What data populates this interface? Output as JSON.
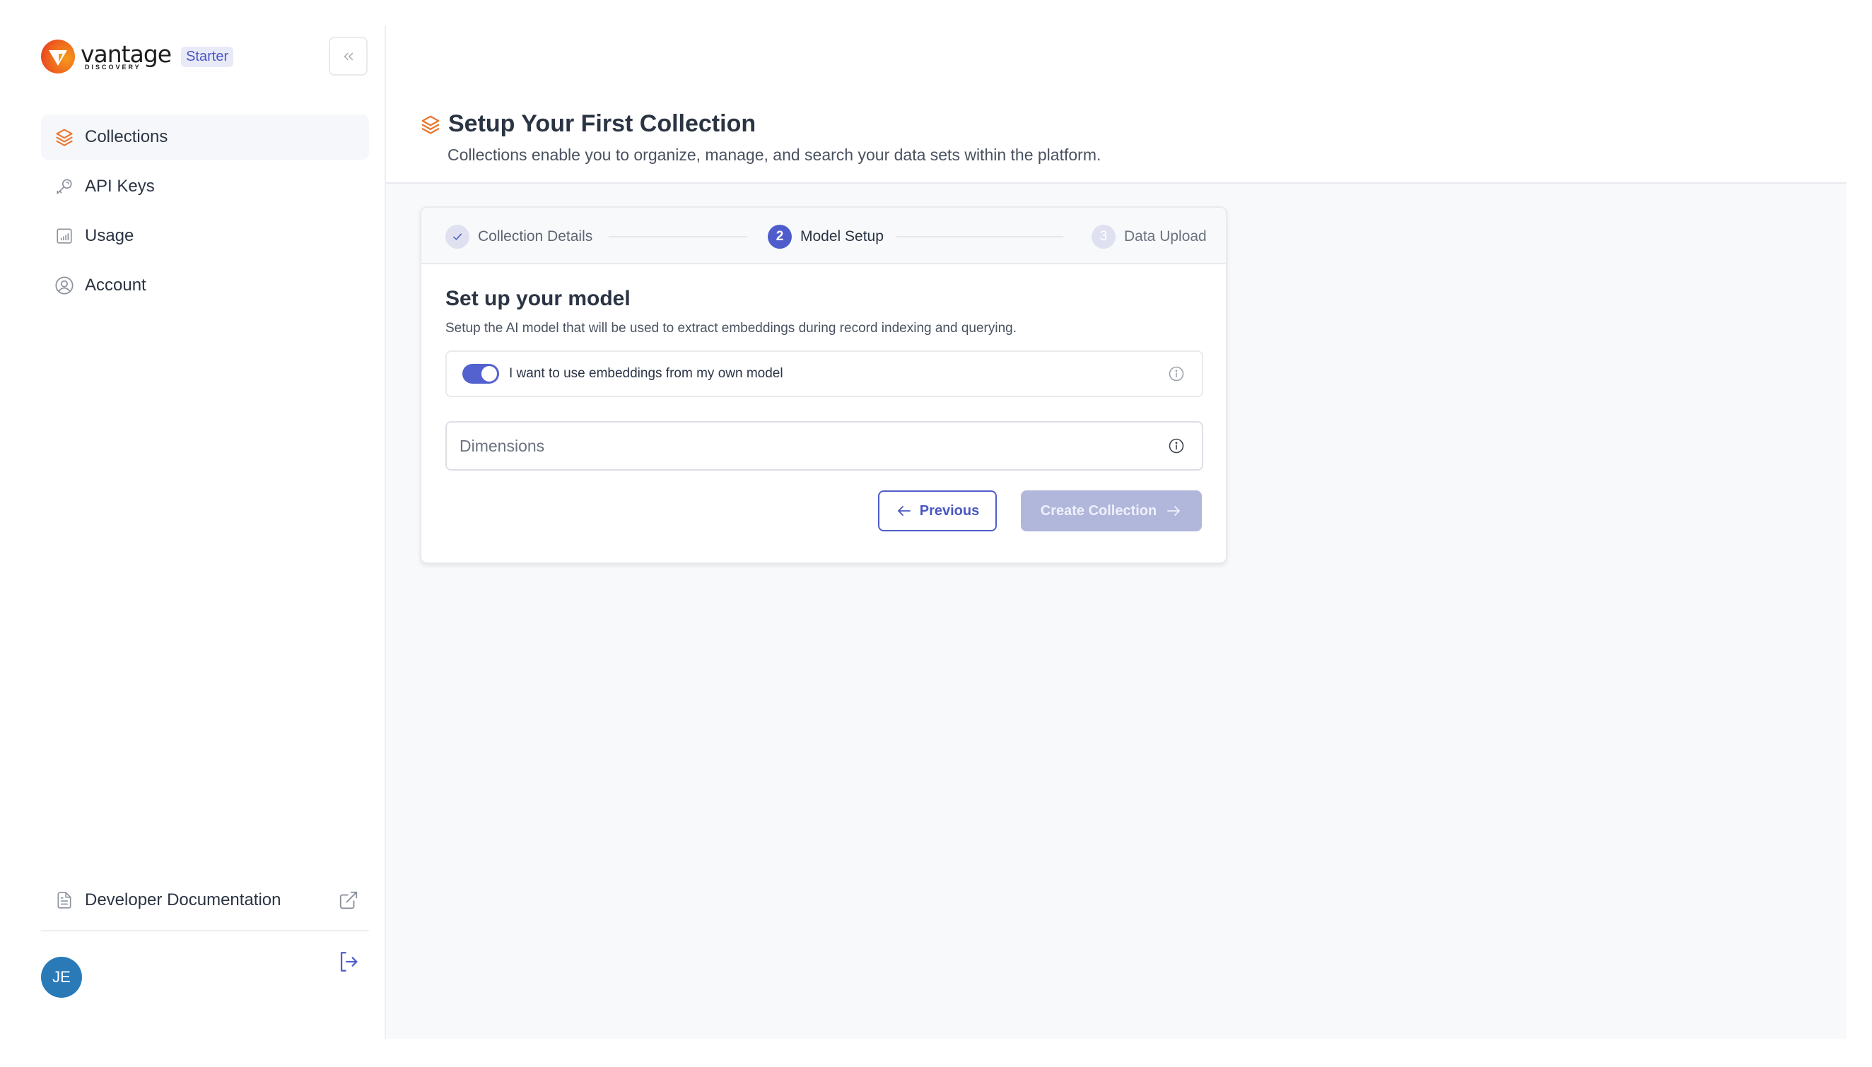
{
  "brand": {
    "name": "vantage",
    "tagline": "DISCOVERY",
    "plan_badge": "Starter"
  },
  "sidebar": {
    "collapse_icon": "chevrons-left-icon",
    "items": [
      {
        "label": "Collections",
        "icon": "layers-icon",
        "active": true
      },
      {
        "label": "API Keys",
        "icon": "key-icon",
        "active": false
      },
      {
        "label": "Usage",
        "icon": "bar-chart-icon",
        "active": false
      },
      {
        "label": "Account",
        "icon": "user-circle-icon",
        "active": false
      }
    ],
    "docs_link": {
      "label": "Developer Documentation",
      "icon": "document-icon",
      "external_icon": "external-link-icon"
    },
    "user": {
      "initials": "JE",
      "avatar_color": "#2a7ab8"
    },
    "logout_icon": "logout-icon"
  },
  "header": {
    "title": "Setup Your First Collection",
    "subtitle": "Collections enable you to organize, manage, and search your data sets within the platform.",
    "icon": "layers-icon"
  },
  "stepper": {
    "steps": [
      {
        "number": "1",
        "label": "Collection Details",
        "status": "completed"
      },
      {
        "number": "2",
        "label": "Model Setup",
        "status": "active"
      },
      {
        "number": "3",
        "label": "Data Upload",
        "status": "upcoming"
      }
    ]
  },
  "form": {
    "section_title": "Set up your model",
    "section_description": "Setup the AI model that will be used to extract embeddings during record indexing and querying.",
    "own_model_toggle": {
      "label": "I want to use embeddings from my own model",
      "checked": true
    },
    "dimensions_field": {
      "placeholder": "Dimensions",
      "value": ""
    },
    "buttons": {
      "previous": "Previous",
      "create": "Create Collection",
      "create_disabled": true
    }
  },
  "colors": {
    "accent": "#4f5dcc",
    "brand_orange": "#f0641e",
    "disabled_button": "#b1b6db",
    "page_background": "#f8f9fb"
  }
}
